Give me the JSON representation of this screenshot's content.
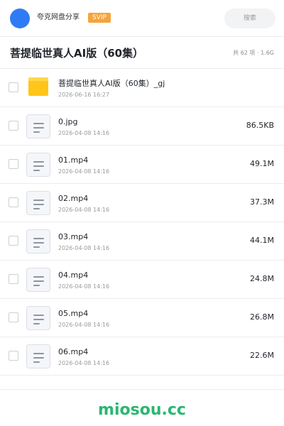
{
  "header": {
    "share_name": "夸克网盘分享",
    "badge": "SVIP",
    "search_placeholder": "搜索"
  },
  "colors": {
    "avatar": "#2f7bf5",
    "svip_badge": "#f7a33b",
    "folder": "#ffc619",
    "watermark": "#2bb673"
  },
  "page": {
    "title": "菩提临世真人AI版（60集）",
    "summary": "共 62 项 · 1.6G"
  },
  "files": [
    {
      "name": "菩提临世真人AI版（60集）_gj",
      "date": "2026-06-16 16:27",
      "size": "",
      "icon": "folder-icon"
    },
    {
      "name": "0.jpg",
      "date": "2026-04-08 14:16",
      "size": "86.5KB",
      "icon": "document-icon"
    },
    {
      "name": "01.mp4",
      "date": "2026-04-08 14:16",
      "size": "49.1M",
      "icon": "document-icon"
    },
    {
      "name": "02.mp4",
      "date": "2026-04-08 14:16",
      "size": "37.3M",
      "icon": "document-icon"
    },
    {
      "name": "03.mp4",
      "date": "2026-04-08 14:16",
      "size": "44.1M",
      "icon": "document-icon"
    },
    {
      "name": "04.mp4",
      "date": "2026-04-08 14:16",
      "size": "24.8M",
      "icon": "document-icon"
    },
    {
      "name": "05.mp4",
      "date": "2026-04-08 14:16",
      "size": "26.8M",
      "icon": "document-icon"
    },
    {
      "name": "06.mp4",
      "date": "2026-04-08 14:16",
      "size": "22.6M",
      "icon": "document-icon"
    }
  ],
  "footer": {
    "watermark": "miosou.cc"
  }
}
